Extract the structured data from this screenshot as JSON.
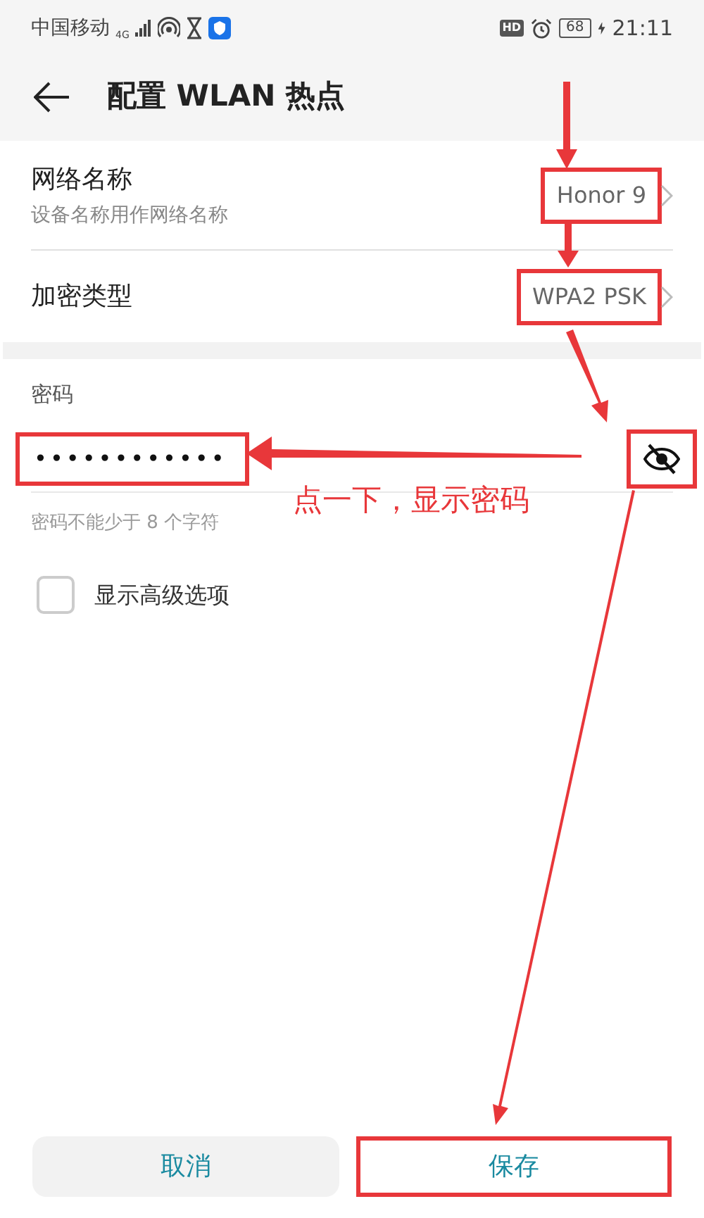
{
  "status_bar": {
    "carrier": "中国移动",
    "network_type": "4G",
    "hd_badge": "HD",
    "battery": "68",
    "time": "21:11"
  },
  "header": {
    "title": "配置 WLAN 热点"
  },
  "settings": [
    {
      "label": "网络名称",
      "sublabel": "设备名称用作网络名称",
      "value": "Honor 9",
      "highlighted": true
    },
    {
      "label": "加密类型",
      "value": "WPA2 PSK",
      "highlighted": true
    }
  ],
  "password": {
    "label": "密码",
    "value": "••••••••••••",
    "masked": true,
    "highlighted": true,
    "toggle_highlighted": true,
    "hint": "密码不能少于 8 个字符"
  },
  "advanced_option": {
    "label": "显示高级选项",
    "checked": false
  },
  "annotation": {
    "text": "点一下，显示密码"
  },
  "buttons": [
    {
      "label": "取消",
      "highlighted": false
    },
    {
      "label": "保存",
      "highlighted": true
    }
  ]
}
